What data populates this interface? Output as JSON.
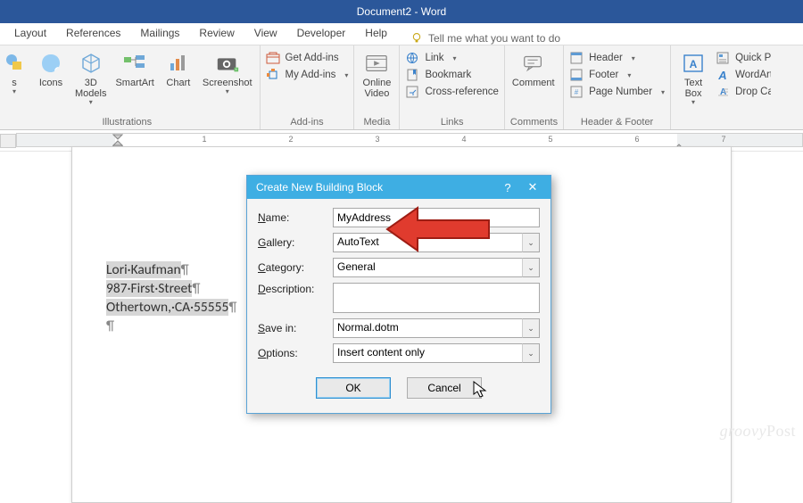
{
  "title": "Document2 - Word",
  "tabs": [
    "Layout",
    "References",
    "Mailings",
    "Review",
    "View",
    "Developer",
    "Help"
  ],
  "tellme": "Tell me what you want to do",
  "ribbon": {
    "illustrations": {
      "label": "Illustrations",
      "shapesBtn": "s",
      "icons": "Icons",
      "models": "3D\nModels",
      "smartart": "SmartArt",
      "chart": "Chart",
      "screenshot": "Screenshot"
    },
    "addins": {
      "label": "Add-ins",
      "get": "Get Add-ins",
      "my": "My Add-ins"
    },
    "media": {
      "label": "Media",
      "video": "Online\nVideo"
    },
    "links": {
      "label": "Links",
      "link": "Link",
      "bookmark": "Bookmark",
      "xref": "Cross-reference"
    },
    "comments": {
      "label": "Comments",
      "comment": "Comment"
    },
    "hf": {
      "label": "Header & Footer",
      "header": "Header",
      "footer": "Footer",
      "page": "Page Number"
    },
    "text": {
      "label": "",
      "box": "Text\nBox",
      "quick": "Quick Pa",
      "wordart": "WordArt",
      "drop": "Drop Ca"
    }
  },
  "ruler_numbers": [
    "1",
    "2",
    "3",
    "4",
    "5",
    "6",
    "7"
  ],
  "document": {
    "l1": "Lori·Kaufman",
    "l2": "987·First·Street",
    "l3": "Othertown,·CA·55555",
    "pil": "¶"
  },
  "dialog": {
    "title": "Create New Building Block",
    "labels": {
      "name": "Name:",
      "gallery": "Gallery:",
      "category": "Category:",
      "description": "Description:",
      "savein": "Save in:",
      "options": "Options:"
    },
    "values": {
      "name": "MyAddress",
      "gallery": "AutoText",
      "category": "General",
      "description": "",
      "savein": "Normal.dotm",
      "options": "Insert content only"
    },
    "ok": "OK",
    "cancel": "Cancel"
  },
  "watermark": "groovyPost"
}
